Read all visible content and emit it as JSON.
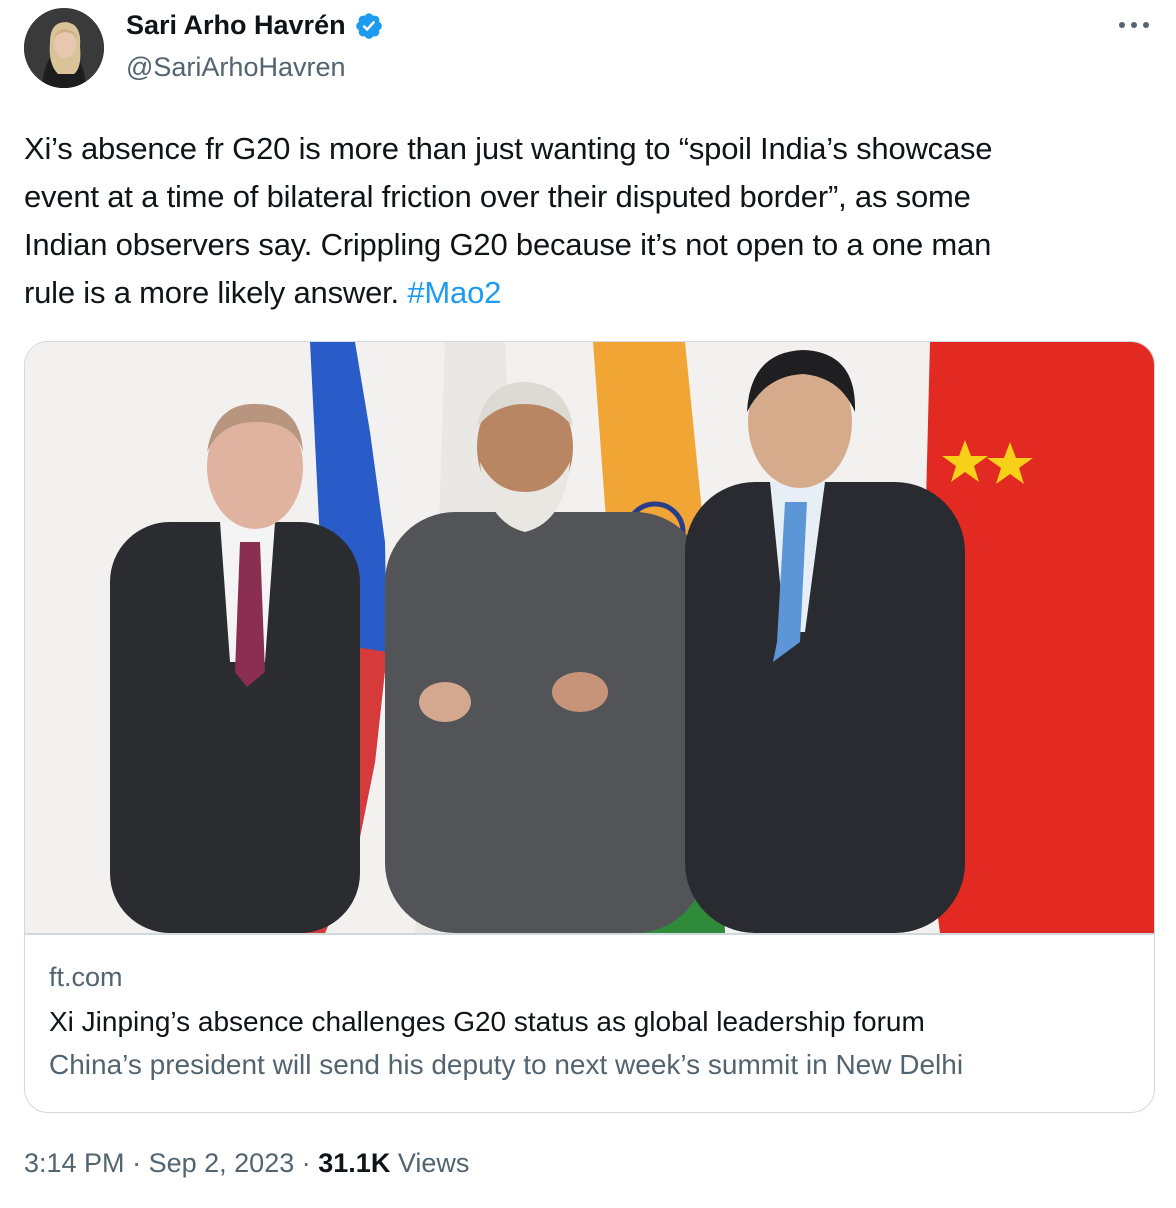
{
  "author": {
    "name": "Sari Arho Havrén",
    "handle": "@SariArhoHavren",
    "verified": true,
    "verified_color": "#1d9bf0"
  },
  "tweet": {
    "lines": [
      "Xi’s absence fr G20 is more than just wanting to “spoil India’s showcase",
      "event at a time of bilateral friction over their disputed border”, as some",
      "Indian observers say. Crippling G20 because it’s not open to a one man",
      "rule is a more likely answer."
    ],
    "hashtag": "#Mao2",
    "hashtag_color": "#1d9bf0"
  },
  "card": {
    "domain": "ft.com",
    "title": "Xi Jinping’s absence challenges G20 status as global leadership forum",
    "description": "China’s president will send his deputy to next week’s summit in New Delhi"
  },
  "meta": {
    "time": "3:14 PM",
    "separator": "·",
    "date": "Sep 2, 2023",
    "views_count": "31.1K",
    "views_label": "Views"
  },
  "icons": {
    "more": "more-horizontal-icon",
    "verified": "verified-badge-icon"
  }
}
